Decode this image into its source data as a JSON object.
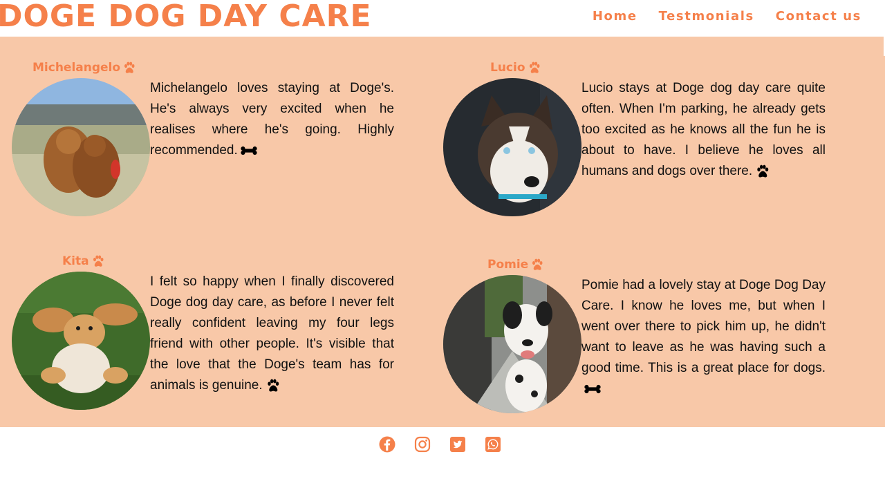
{
  "header": {
    "brand": "DOGE DOG DAY CARE",
    "nav": [
      "Home",
      "Testmonials",
      "Contact us"
    ]
  },
  "testimonials": [
    {
      "name": "Michelangelo",
      "text": "Michelangelo loves staying at Doge's. He's always very excited when he realises where he's going. Highly recommended.",
      "trailing_icon": "bone-icon"
    },
    {
      "name": "Lucio",
      "text": "Lucio stays at Doge dog day care quite often. When I'm parking, he already gets too excited as he knows all the fun he is about to have. I believe he loves all humans and dogs over there.",
      "trailing_icon": "paw-icon"
    },
    {
      "name": "Kita",
      "text": "I felt so happy when I finally discovered Doge dog day care, as before I never felt really confident leaving my four legs friend with other people. It's visible that the love that the Doge's team has for animals is genuine.",
      "trailing_icon": "paw-icon"
    },
    {
      "name": "Pomie",
      "text": "Pomie had a lovely stay at Doge Dog Day Care. I know he loves me, but when I went over there to pick him up, he didn't want to leave as he was having such a good time. This is a great place for dogs.",
      "trailing_icon": "bone-icon"
    }
  ],
  "footer": {
    "social": [
      "facebook-icon",
      "instagram-icon",
      "twitter-icon",
      "whatsapp-icon"
    ]
  },
  "colors": {
    "accent": "#f5804a",
    "section_bg": "#f8c8a8",
    "text": "#111111"
  }
}
